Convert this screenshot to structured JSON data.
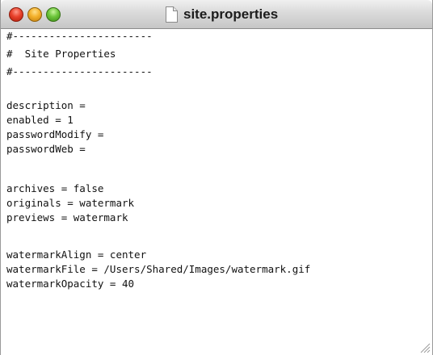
{
  "window": {
    "title": "site.properties",
    "controls": {
      "close_icon": "close-icon",
      "minimize_icon": "minimize-icon",
      "zoom_icon": "zoom-icon"
    },
    "colors": {
      "close": "#e8412b",
      "minimize": "#f3b02a",
      "zoom": "#6cc53a"
    }
  },
  "editor": {
    "lines": [
      "#-----------------------",
      "#  Site Properties",
      "#-----------------------",
      "",
      "description =",
      "enabled = 1",
      "passwordModify =",
      "passwordWeb =",
      "",
      "archives = false",
      "originals = watermark",
      "previews = watermark",
      "",
      "watermarkAlign = center",
      "watermarkFile = /Users/Shared/Images/watermark.gif",
      "watermarkOpacity = 40"
    ]
  }
}
